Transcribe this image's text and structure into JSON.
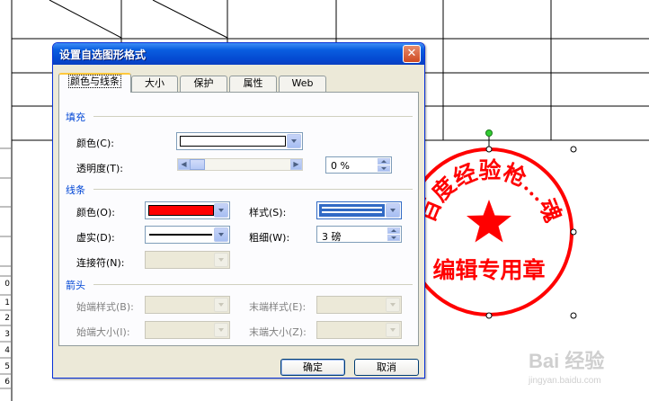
{
  "dialog": {
    "title": "设置自选图形格式",
    "close_symbol": "✕",
    "tabs": [
      {
        "label": "颜色与线条"
      },
      {
        "label": "大小"
      },
      {
        "label": "保护"
      },
      {
        "label": "属性"
      },
      {
        "label": "Web"
      }
    ],
    "fill": {
      "section_title": "填充",
      "color_label": "颜色(C):",
      "color_value": "#ffffff",
      "transparency_label": "透明度(T):",
      "transparency_value": "0 %",
      "transparency_fraction": 0.0
    },
    "line": {
      "section_title": "线条",
      "color_label": "颜色(O):",
      "color_value": "#ff0000",
      "style_label": "样式(S):",
      "dash_label": "虚实(D):",
      "weight_label": "粗细(W):",
      "weight_value": "3 磅",
      "connector_label": "连接符(N):"
    },
    "arrows": {
      "section_title": "箭头",
      "begin_style_label": "始端样式(B):",
      "end_style_label": "末端样式(E):",
      "begin_size_label": "始端大小(I):",
      "end_size_label": "末端大小(Z):"
    },
    "ok_label": "确定",
    "cancel_label": "取消"
  },
  "sheet": {
    "row_numbers": [
      "0",
      "1",
      "2",
      "3",
      "4",
      "5",
      "6"
    ]
  },
  "stamp": {
    "arc_text": "百度经验枪…魂",
    "center_text": "编辑专用章",
    "color": "#ff0000"
  },
  "watermark": {
    "brand": "Bai 经验",
    "url": "jingyan.baidu.com"
  },
  "colors": {
    "title_bar": "#0449d1",
    "section_title": "#0046d5",
    "dialog_bg": "#ece9d8"
  }
}
